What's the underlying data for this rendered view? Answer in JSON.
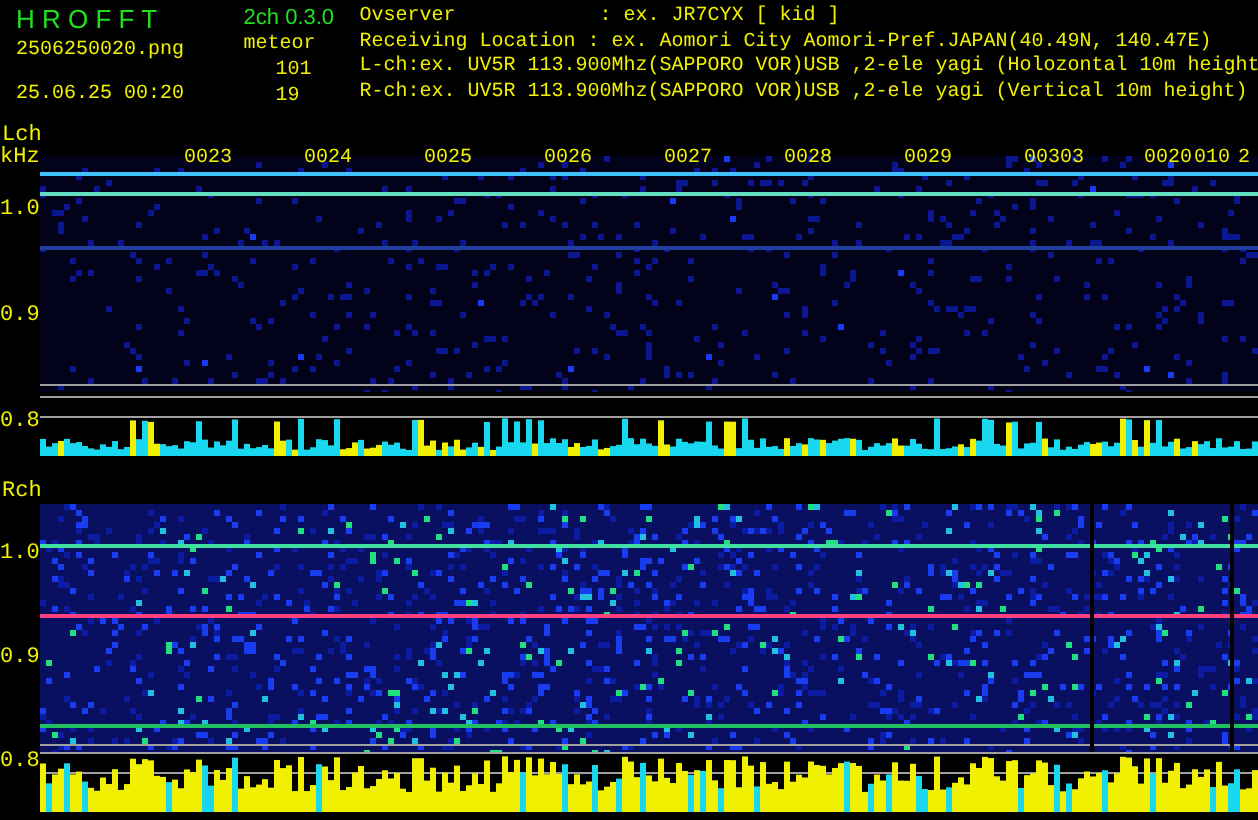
{
  "header": {
    "app_title": "H R O F F T",
    "version": "2ch 0.3.0",
    "file_name": "2506250020.png",
    "date_time": "25.06.25 00:20",
    "mode": "meteor",
    "l_count": "101",
    "r_count": "19",
    "info_lines": [
      "Ovserver            : ex. JR7CYX [ kid ]",
      "Receiving Location : ex. Aomori City Aomori-Pref.JAPAN(40.49N, 140.47E)",
      "L-ch:ex. UV5R 113.900Mhz(SAPPORO VOR)USB ,2-ele yagi (Holozontal 10m height",
      "R-ch:ex. UV5R 113.900Mhz(SAPPORO VOR)USB ,2-ele yagi (Vertical 10m height)"
    ]
  },
  "channels": [
    {
      "label": "Lch",
      "unit": "kHz",
      "time_labels": [
        "0023",
        "0024",
        "0025",
        "0026",
        "0027",
        "0028",
        "0029",
        "00303",
        "0020",
        "010",
        "2"
      ],
      "axis_labels": [
        "1.0",
        "0.9",
        "0.8"
      ]
    },
    {
      "label": "Rch",
      "axis_labels": [
        "1.0",
        "0.9",
        "0.8"
      ]
    }
  ]
}
